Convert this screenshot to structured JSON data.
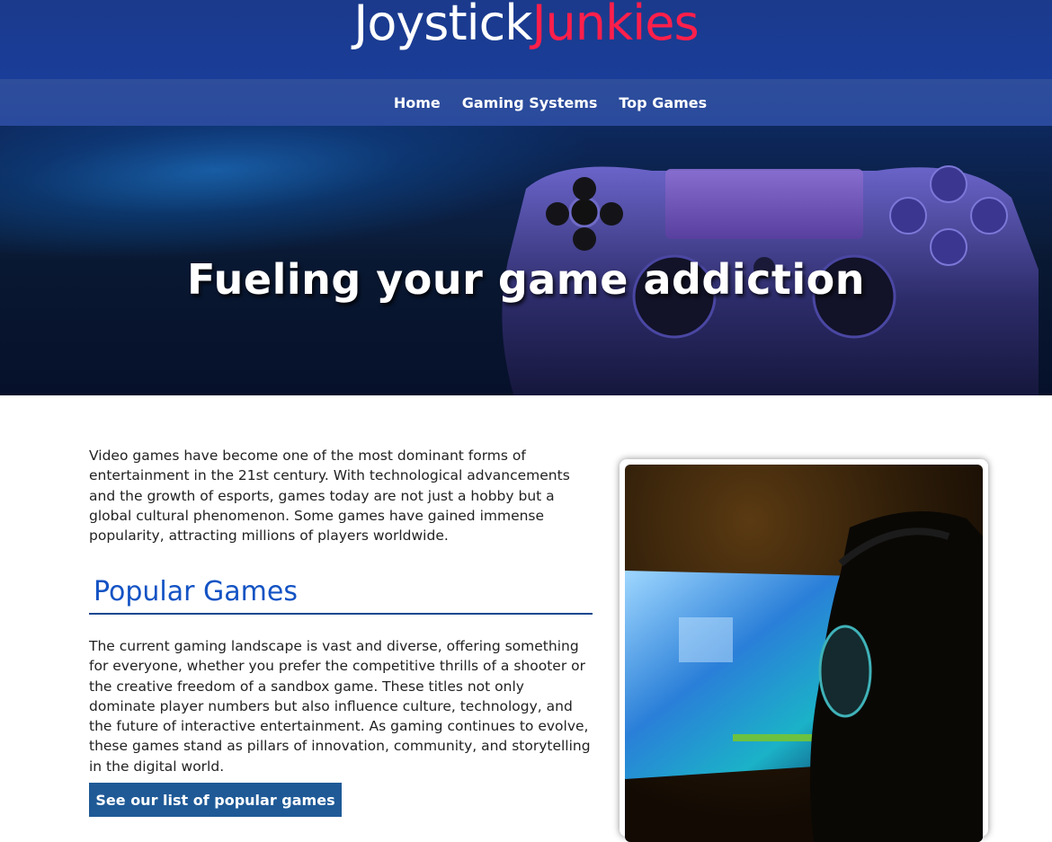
{
  "logo": {
    "part1": "Joystick",
    "part2": "Junkies"
  },
  "nav": {
    "items": [
      "Home",
      "Gaming Systems",
      "Top Games"
    ]
  },
  "hero": {
    "title": "Fueling your game addiction"
  },
  "intro": {
    "text": "Video games have become one of the most dominant forms of entertainment in the 21st century. With technological advancements and the growth of esports, games today are not just a hobby but a global cultural phenomenon. Some games have gained immense popularity, attracting millions of players worldwide."
  },
  "popular": {
    "heading": "Popular Games",
    "text": "The current gaming landscape is vast and diverse, offering something for everyone, whether you prefer the competitive thrills of a shooter or the creative freedom of a sandbox game. These titles not only dominate player numbers but also influence culture, technology, and the future of interactive entertainment. As gaming continues to evolve, these games stand as pillars of innovation, community, and storytelling in the digital world.",
    "button_label": "See our list of popular games"
  },
  "colors": {
    "brand_blue": "#1a3d99",
    "logo_red": "#ff1f4b",
    "heading_blue": "#1353c4",
    "button": "#1f5a97"
  }
}
